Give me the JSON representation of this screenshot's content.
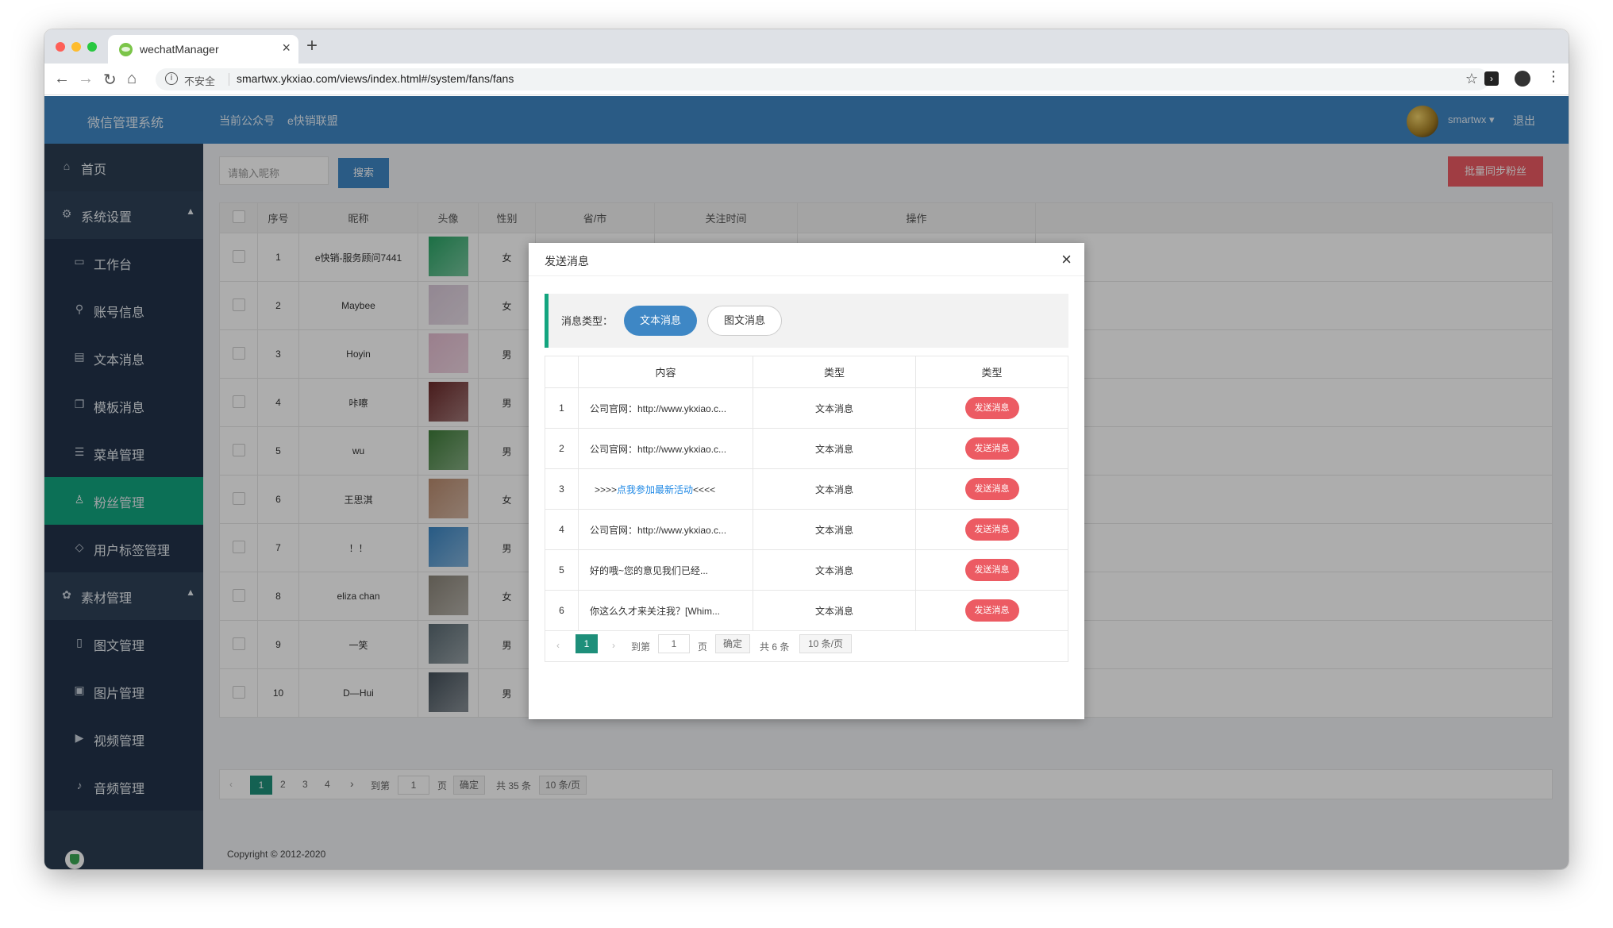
{
  "browser": {
    "tab_title": "wechatManager",
    "insecure_label": "不安全",
    "url": "smartwx.ykxiao.com/views/index.html#/system/fans/fans"
  },
  "header": {
    "brand": "微信管理系统",
    "nav": [
      "当前公众号",
      "e快销联盟"
    ],
    "username": "smartwx",
    "logout": "退出"
  },
  "sidebar": {
    "items": [
      {
        "label": "首页",
        "icon": "home-icon"
      },
      {
        "label": "系统设置",
        "icon": "gear-icon"
      },
      {
        "label": "工作台",
        "icon": "monitor-icon"
      },
      {
        "label": "账号信息",
        "icon": "link-icon"
      },
      {
        "label": "文本消息",
        "icon": "message-icon"
      },
      {
        "label": "模板消息",
        "icon": "template-icon"
      },
      {
        "label": "菜单管理",
        "icon": "menu-icon"
      },
      {
        "label": "粉丝管理",
        "icon": "user-icon"
      },
      {
        "label": "用户标签管理",
        "icon": "tag-icon"
      },
      {
        "label": "素材管理",
        "icon": "material-icon"
      },
      {
        "label": "图文管理",
        "icon": "document-icon"
      },
      {
        "label": "图片管理",
        "icon": "image-icon"
      },
      {
        "label": "视频管理",
        "icon": "video-icon"
      },
      {
        "label": "音频管理",
        "icon": "audio-icon"
      }
    ]
  },
  "toolbar": {
    "search_placeholder": "请输入昵称",
    "search_button": "搜索",
    "sync_button": "批量同步粉丝"
  },
  "fans_table": {
    "headers": [
      "序号",
      "昵称",
      "头像",
      "性别",
      "省/市",
      "关注时间",
      "操作"
    ],
    "rows": [
      {
        "no": "1",
        "nickname": "e快销-服务顾问7441",
        "gender": "女",
        "avatar_color": "#2aa566"
      },
      {
        "no": "2",
        "nickname": "Maybee",
        "gender": "女",
        "avatar_color": "#d9c8d8"
      },
      {
        "no": "3",
        "nickname": "Hoyin",
        "gender": "男",
        "avatar_color": "#e4bcd0"
      },
      {
        "no": "4",
        "nickname": "咔嚓",
        "gender": "男",
        "avatar_color": "#6b2a2a"
      },
      {
        "no": "5",
        "nickname": "wu",
        "gender": "男",
        "avatar_color": "#3f7d3a"
      },
      {
        "no": "6",
        "nickname": "王思淇",
        "gender": "女",
        "avatar_color": "#b98b6e"
      },
      {
        "no": "7",
        "nickname": "！！",
        "gender": "男",
        "avatar_color": "#3b86c4"
      },
      {
        "no": "8",
        "nickname": "eliza chan",
        "gender": "女",
        "avatar_color": "#8a8478"
      },
      {
        "no": "9",
        "nickname": "一笑",
        "gender": "男",
        "avatar_color": "#5a6a72"
      },
      {
        "no": "10",
        "nickname": "D—Hui",
        "gender": "男",
        "avatar_color": "#44505a"
      }
    ]
  },
  "fans_pager": {
    "pages": [
      "1",
      "2",
      "3",
      "4"
    ],
    "goto_label": "到第",
    "goto_value": "1",
    "page_unit": "页",
    "confirm": "确定",
    "total": "共 35 条",
    "page_size": "10 条/页"
  },
  "footer": {
    "copyright": "Copyright © 2012-2020"
  },
  "modal": {
    "title": "发送消息",
    "type_label": "消息类型：",
    "type_text": "文本消息",
    "type_news": "图文消息",
    "headers": [
      "内容",
      "类型",
      "类型"
    ],
    "rows": [
      {
        "no": "1",
        "content": "公司官网：http://www.ykxiao.c...",
        "type": "文本消息",
        "action": "发送消息"
      },
      {
        "no": "2",
        "content": "公司官网：http://www.ykxiao.c...",
        "type": "文本消息",
        "action": "发送消息"
      },
      {
        "no": "3",
        "content_prefix": ">>>>",
        "content_link": "点我参加最新活动",
        "content_suffix": "<<<<",
        "type": "文本消息",
        "action": "发送消息"
      },
      {
        "no": "4",
        "content": "公司官网：http://www.ykxiao.c...",
        "type": "文本消息",
        "action": "发送消息"
      },
      {
        "no": "5",
        "content": "好的哦~您的意见我们已经...",
        "type": "文本消息",
        "action": "发送消息"
      },
      {
        "no": "6",
        "content": "你这么久才来关注我？[Whim...",
        "type": "文本消息",
        "action": "发送消息"
      }
    ],
    "pager": {
      "current": "1",
      "goto_label": "到第",
      "goto_value": "1",
      "page_unit": "页",
      "confirm": "确定",
      "total": "共 6 条",
      "page_size": "10 条/页"
    }
  }
}
